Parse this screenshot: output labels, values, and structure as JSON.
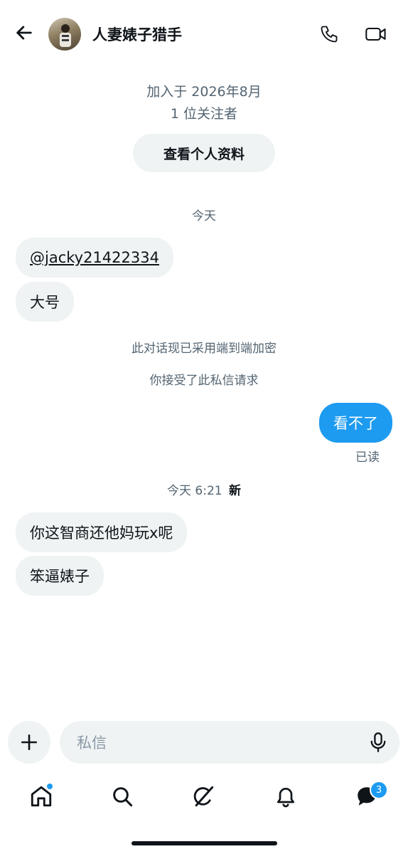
{
  "header": {
    "name": "人妻婊子猎手",
    "icons": [
      "back-arrow-icon",
      "phone-icon",
      "video-icon"
    ]
  },
  "profile": {
    "joined": "加入于 2026年8月",
    "followers": "1 位关注者",
    "view_profile_label": "查看个人资料"
  },
  "conversation": {
    "date_label_1": "今天",
    "incoming_1": [
      "@jacky21422334",
      "大号"
    ],
    "system_messages": [
      "此对话现已采用端到端加密",
      "你接受了此私信请求"
    ],
    "outgoing": {
      "text": "看不了",
      "status": "已读"
    },
    "date_label_2_time": "今天 6:21",
    "date_label_2_new": "新",
    "incoming_2": [
      "你这智商还他妈玩x呢",
      "笨逼婊子"
    ]
  },
  "composer": {
    "placeholder": "私信",
    "icons": [
      "plus-icon",
      "microphone-icon"
    ]
  },
  "tabbar": {
    "icons": [
      "home-icon",
      "search-icon",
      "grok-icon",
      "bell-icon",
      "messages-icon"
    ],
    "messages_badge": "3"
  },
  "colors": {
    "accent": "#1d9bf0",
    "bubble": "#eff3f4",
    "muted_text": "#536471",
    "text": "#0f1419"
  }
}
